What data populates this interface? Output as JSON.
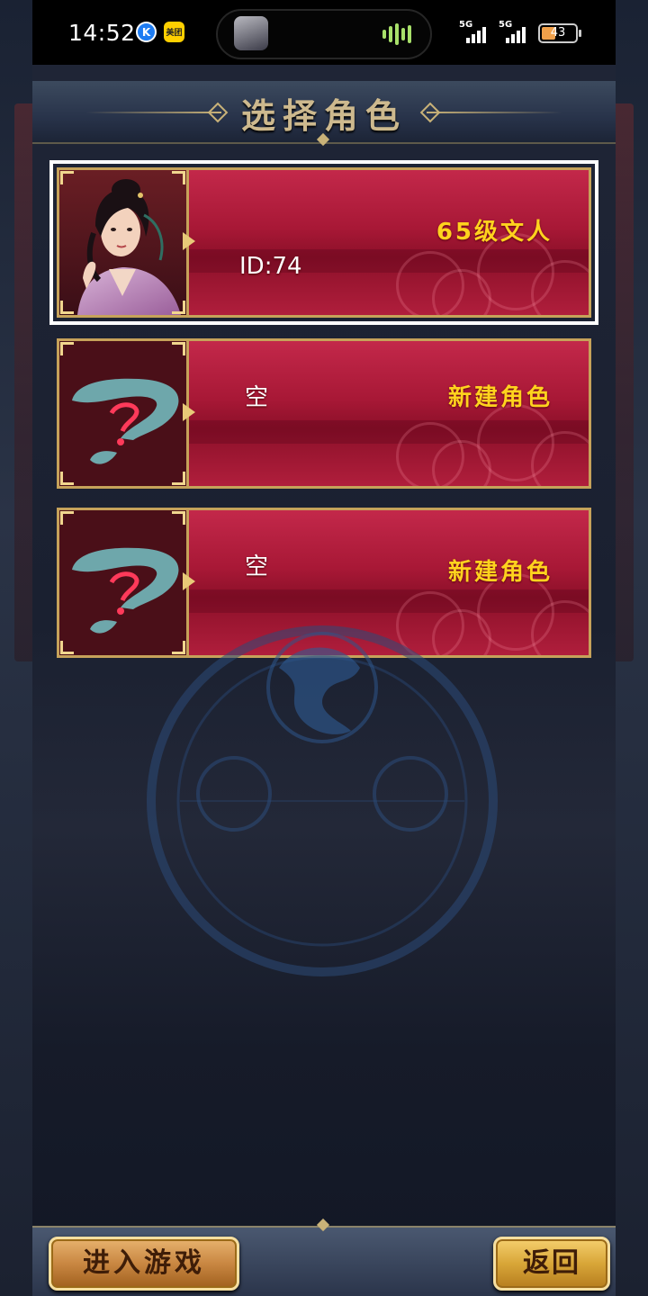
{
  "status_bar": {
    "time": "14:52",
    "app_icons": [
      "k-app-icon",
      "meituan-icon"
    ],
    "meituan_label": "美团",
    "k_label": "K",
    "signal_1_label": "5G",
    "signal_2_label": "5G",
    "battery_percent": "43",
    "battery_level": 0.43
  },
  "header": {
    "title": "选择角色"
  },
  "slots": [
    {
      "left_text": "ID:74",
      "right_text": "65级文人",
      "has_character": true,
      "selected": true
    },
    {
      "left_text": "空",
      "right_text": "新建角色",
      "has_character": false,
      "selected": false
    },
    {
      "left_text": "空",
      "right_text": "新建角色",
      "has_character": false,
      "selected": false
    }
  ],
  "footer": {
    "enter_game_label": "进入游戏",
    "back_label": "返回"
  },
  "colors": {
    "accent_gold": "#ffd21e",
    "card_red": "#a81836",
    "frame_gold": "#c6a25a"
  }
}
